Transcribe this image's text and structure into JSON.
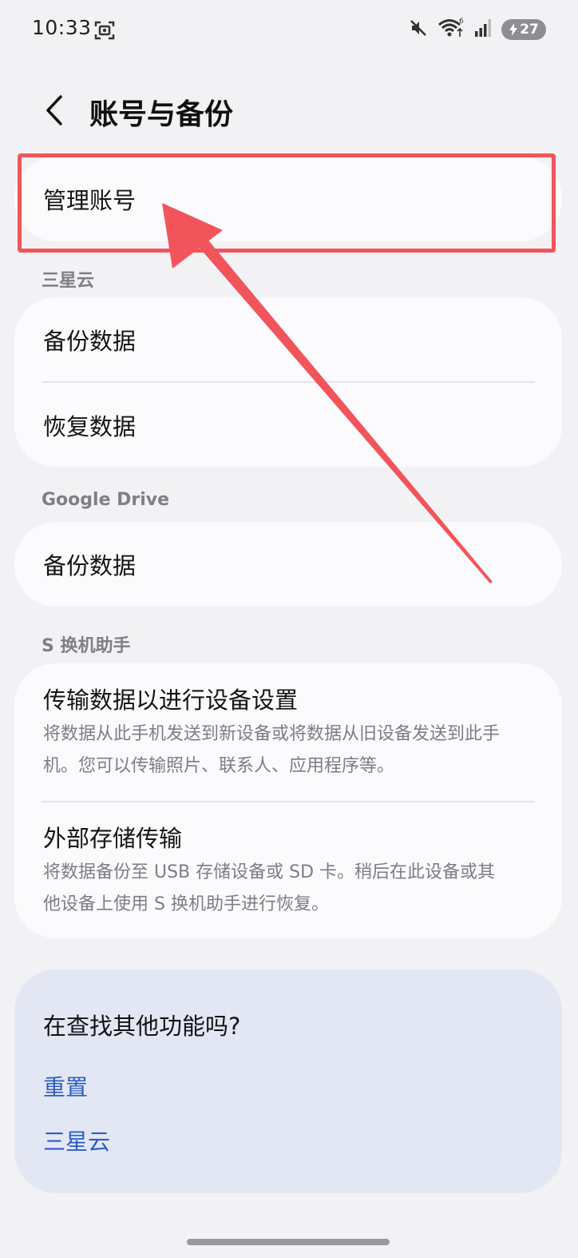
{
  "status_bar": {
    "time": "10:33",
    "battery_level": "27",
    "icons": [
      "screenshot-icon",
      "mute-icon",
      "wifi-icon",
      "signal-icon",
      "battery-charging-icon"
    ]
  },
  "header": {
    "back_icon": "chevron-left-icon",
    "title": "账号与备份"
  },
  "manage_account": {
    "label": "管理账号"
  },
  "sections": [
    {
      "label": "三星云",
      "items": [
        {
          "title": "备份数据"
        },
        {
          "title": "恢复数据"
        }
      ]
    },
    {
      "label": "Google Drive",
      "items": [
        {
          "title": "备份数据"
        }
      ]
    },
    {
      "label": "S 换机助手",
      "items": [
        {
          "title": "传输数据以进行设备设置",
          "subtitle_line1": "将数据从此手机发送到新设备或将数据从旧设备发送到此手",
          "subtitle_line2": "机。您可以传输照片、联系人、应用程序等。"
        },
        {
          "title": "外部存储传输",
          "subtitle_line1": "将数据备份至 USB 存储设备或 SD 卡。稍后在此设备或其",
          "subtitle_line2": "他设备上使用 S 换机助手进行恢复。"
        }
      ]
    }
  ],
  "looking_for_more": {
    "title": "在查找其他功能吗?",
    "links": [
      "重置",
      "三星云"
    ]
  },
  "annotation": {
    "highlight_color": "#f2545b"
  },
  "colors": {
    "background": "#f2f2f4",
    "card": "#fbfbfd",
    "footer_card": "#e3e7f4",
    "link": "#2c5cc5"
  }
}
